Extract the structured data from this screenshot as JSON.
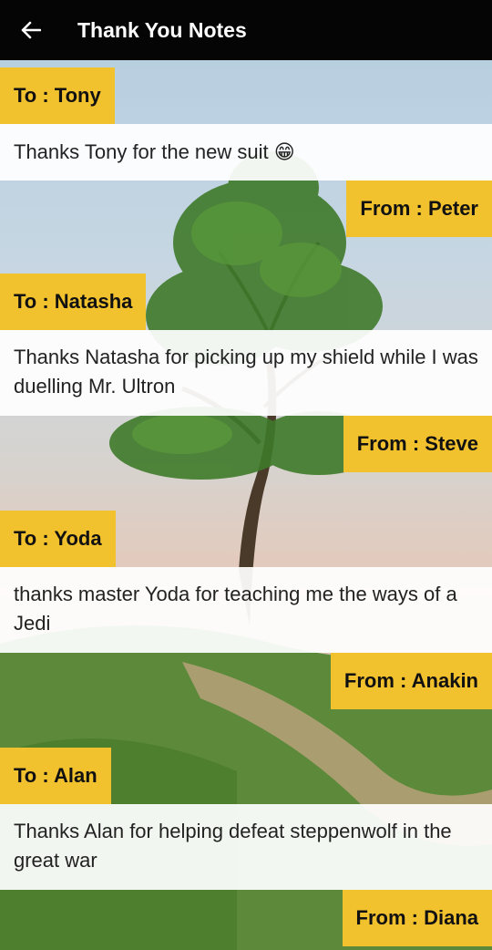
{
  "appbar": {
    "title": "Thank You Notes",
    "back_icon": "arrow-left-icon"
  },
  "colors": {
    "appbar": "#050505",
    "tag": "#f2c12e",
    "card": "#ffffff"
  },
  "notes": [
    {
      "to": "To : Tony",
      "message": "Thanks Tony for the new suit 😁",
      "from": "From : Peter"
    },
    {
      "to": "To : Natasha",
      "message": "Thanks Natasha for picking up my shield while I was duelling Mr. Ultron",
      "from": "From : Steve"
    },
    {
      "to": "To : Yoda",
      "message": "thanks master Yoda for teaching me the ways of a Jedi",
      "from": "From : Anakin"
    },
    {
      "to": "To : Alan",
      "message": "Thanks Alan for helping defeat steppenwolf in the great war",
      "from": "From : Diana"
    }
  ]
}
